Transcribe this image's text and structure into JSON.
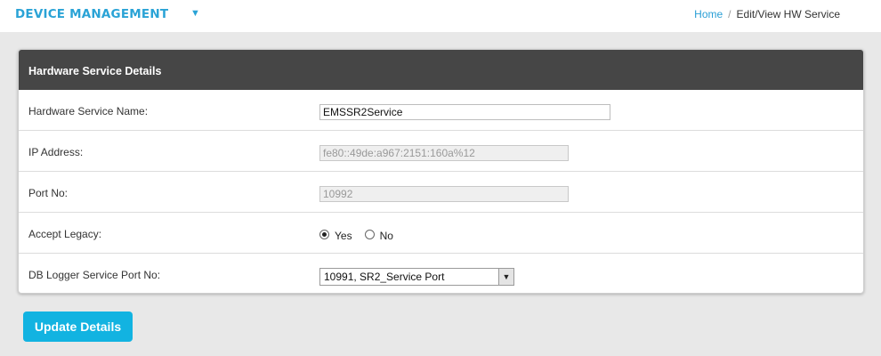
{
  "header": {
    "app_title": "DEVICE MANAGEMENT",
    "menu_caret": "▼",
    "breadcrumb": {
      "home": "Home",
      "separator": "/",
      "current": "Edit/View HW Service"
    }
  },
  "panel": {
    "title": "Hardware Service Details",
    "rows": {
      "name": {
        "label": "Hardware Service Name:",
        "value": "EMSSR2Service"
      },
      "ip": {
        "label": "IP Address:",
        "value": "fe80::49de:a967:2151:160a%12"
      },
      "port": {
        "label": "Port No:",
        "value": "10992"
      },
      "legacy": {
        "label": "Accept Legacy:",
        "options": [
          "Yes",
          "No"
        ],
        "selected": "Yes"
      },
      "db_logger": {
        "label": "DB Logger Service Port No:",
        "selected": "10991, SR2_Service Port"
      }
    }
  },
  "actions": {
    "update_label": "Update Details"
  },
  "colors": {
    "accent": "#2aa3d6",
    "header_bg": "#464646",
    "button_bg": "#12b3e1"
  }
}
